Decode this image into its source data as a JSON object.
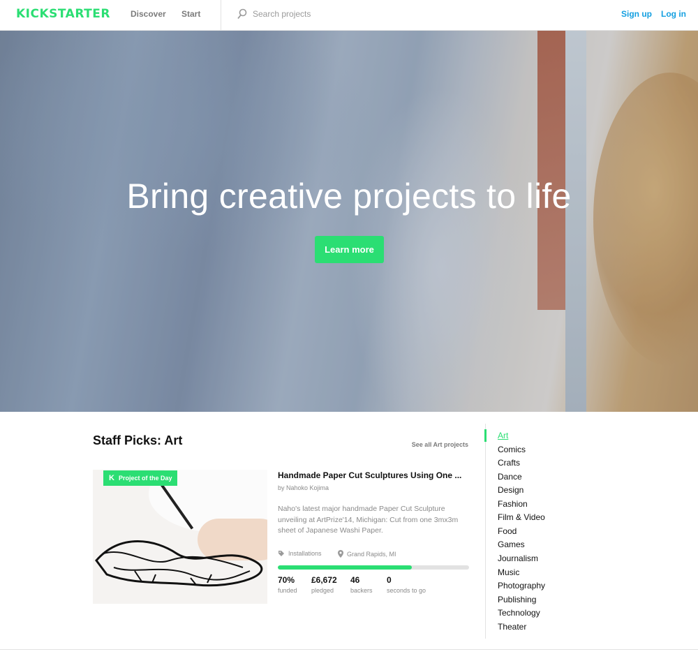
{
  "header": {
    "logo_left": "KICK",
    "logo_right": "STARTER",
    "nav": [
      "Discover",
      "Start"
    ],
    "search_placeholder": "Search projects",
    "sign_up": "Sign up",
    "log_in": "Log in"
  },
  "hero": {
    "title": "Bring creative projects to life",
    "button": "Learn more"
  },
  "staff_picks": {
    "title": "Staff Picks: Art",
    "see_all": "See all Art projects",
    "project": {
      "badge": "Project of the Day",
      "title": "Handmade Paper Cut Sculptures Using One ...",
      "by": "by Nahoko Kojima",
      "description": "Naho's latest major handmade Paper Cut Sculpture unveiling at ArtPrize'14, Michigan: Cut from one 3mx3m sheet of Japanese Washi Paper.",
      "category": "Installations",
      "location": "Grand Rapids, MI",
      "funded_fraction": 0.7,
      "stats": [
        {
          "value": "70%",
          "label": "funded"
        },
        {
          "value": "£6,672",
          "label": "pledged"
        },
        {
          "value": "46",
          "label": "backers"
        },
        {
          "value": "0",
          "label": "seconds to go"
        }
      ]
    }
  },
  "categories": [
    "Art",
    "Comics",
    "Crafts",
    "Dance",
    "Design",
    "Fashion",
    "Film & Video",
    "Food",
    "Games",
    "Journalism",
    "Music",
    "Photography",
    "Publishing",
    "Technology",
    "Theater"
  ],
  "active_category": "Art",
  "colors": {
    "brand_green": "#2bde73",
    "link_blue": "#149fe0"
  }
}
